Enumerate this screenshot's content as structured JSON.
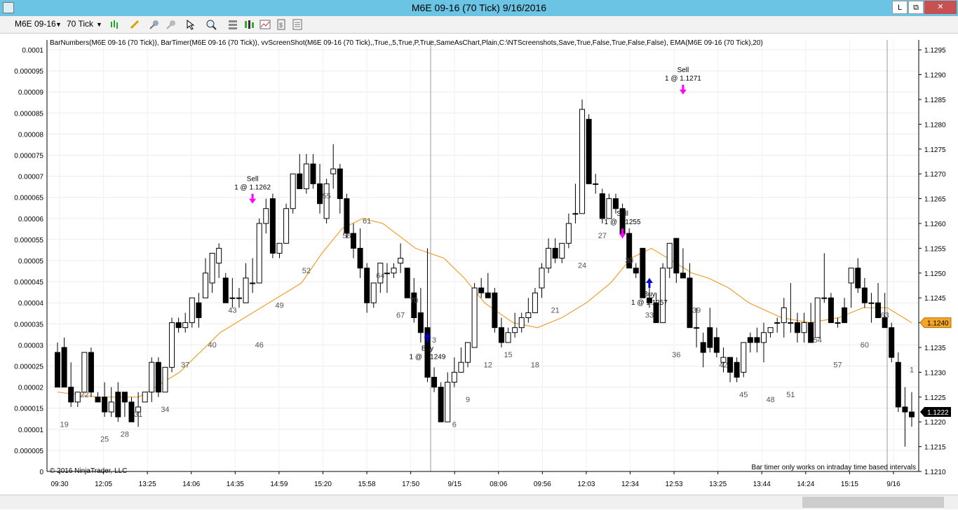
{
  "window": {
    "title": "M6E 09-16 (70 Tick)  9/16/2016",
    "help_label": "L",
    "restore_label": "⧉",
    "close_label": "✕"
  },
  "toolbar": {
    "instrument": "M6E 09-16",
    "interval": "70 Tick",
    "dropdown_icon": "chevron-down-icon"
  },
  "chart": {
    "indicator_label": "BarNumbers(M6E 09-16 (70 Tick)), BarTimer(M6E 09-16 (70 Tick)), vvScreenShot(M6E 09-16 (70 Tick),,True,,5,True,P,True,SameAsChart,Plain,C:\\NTScreenshots,Save,True,False,True,False,False), EMA(M6E 09-16 (70 Tick),20)",
    "copyright": "© 2016 NinjaTrader, LLC",
    "bartimer_msg": "Bar timer only works on intraday time based intervals",
    "left_ticks": [
      "0.0001",
      "0.000095",
      "0.00009",
      "0.000085",
      "0.00008",
      "0.000075",
      "0.00007",
      "0.000065",
      "0.00006",
      "0.000055",
      "0.00005",
      "0.000045",
      "0.00004",
      "0.000035",
      "0.00003",
      "0.000025",
      "0.00002",
      "0.000015",
      "0.00001",
      "0.000005",
      "0"
    ],
    "right_ticks": [
      "1.1295",
      "1.1290",
      "1.1285",
      "1.1280",
      "1.1275",
      "1.1270",
      "1.1265",
      "1.1260",
      "1.1255",
      "1.1250",
      "1.1245",
      "1.1240",
      "1.1235",
      "1.1230",
      "1.1225",
      "1.1220",
      "1.1215",
      "1.1210"
    ],
    "x_labels": [
      "09:30",
      "12:05",
      "13:25",
      "14:06",
      "14:35",
      "14:59",
      "15:20",
      "15:58",
      "17:50",
      "9/15",
      "08:06",
      "09:56",
      "12:03",
      "12:34",
      "12:53",
      "13:25",
      "13:44",
      "14:24",
      "15:15",
      "9/16"
    ],
    "price_ylim": [
      1.121,
      1.1297
    ],
    "last_price": "1.1222",
    "ema_price": "1.1240",
    "colors": {
      "ema": "#f0a030",
      "marker": "#ff00ff",
      "buy": "#0000cc",
      "price_tag": "#f5a623"
    },
    "bars": [
      [
        1.1234,
        1.1236,
        1.1227,
        1.1227
      ],
      [
        1.1235,
        1.1237,
        1.1227,
        1.1227
      ],
      [
        1.1227,
        1.1232,
        1.1223,
        1.1224
      ],
      [
        1.1224,
        1.1226,
        1.1223,
        1.1226
      ],
      [
        1.1226,
        1.1234,
        1.1226,
        1.1234
      ],
      [
        1.1234,
        1.1235,
        1.1225,
        1.1226
      ],
      [
        1.1225,
        1.1226,
        1.1224,
        1.1224
      ],
      [
        1.1225,
        1.1228,
        1.1221,
        1.1222
      ],
      [
        1.1222,
        1.1227,
        1.1221,
        1.1224
      ],
      [
        1.1226,
        1.1228,
        1.122,
        1.1221
      ],
      [
        1.1226,
        1.1226,
        1.1221,
        1.1224
      ],
      [
        1.1224,
        1.1225,
        1.122,
        1.122
      ],
      [
        1.1222,
        1.1226,
        1.1219,
        1.1223
      ],
      [
        1.1224,
        1.1226,
        1.1224,
        1.1226
      ],
      [
        1.1226,
        1.1233,
        1.1224,
        1.1232
      ],
      [
        1.1232,
        1.1233,
        1.1225,
        1.1226
      ],
      [
        1.1226,
        1.1231,
        1.1226,
        1.1231
      ],
      [
        1.1231,
        1.1241,
        1.123,
        1.124
      ],
      [
        1.124,
        1.1241,
        1.1238,
        1.1239
      ],
      [
        1.1239,
        1.1242,
        1.1238,
        1.124
      ],
      [
        1.124,
        1.1245,
        1.1239,
        1.1245
      ],
      [
        1.1244,
        1.1246,
        1.1239,
        1.1241
      ],
      [
        1.1245,
        1.1253,
        1.1245,
        1.125
      ],
      [
        1.1248,
        1.1254,
        1.1246,
        1.1254
      ],
      [
        1.1252,
        1.1256,
        1.1249,
        1.1255
      ],
      [
        1.1249,
        1.125,
        1.1244,
        1.1244
      ],
      [
        1.1245,
        1.1249,
        1.1243,
        1.1245
      ],
      [
        1.1245,
        1.1247,
        1.1243,
        1.1245
      ],
      [
        1.1244,
        1.1252,
        1.1244,
        1.1249
      ],
      [
        1.1248,
        1.1253,
        1.1246,
        1.1248
      ],
      [
        1.1248,
        1.1261,
        1.1248,
        1.126
      ],
      [
        1.126,
        1.1265,
        1.1258,
        1.1263
      ],
      [
        1.1265,
        1.1266,
        1.1253,
        1.1254
      ],
      [
        1.1254,
        1.1256,
        1.1253,
        1.1256
      ],
      [
        1.1256,
        1.1264,
        1.1256,
        1.1263
      ],
      [
        1.1263,
        1.127,
        1.1262,
        1.127
      ],
      [
        1.127,
        1.1274,
        1.1267,
        1.1267
      ],
      [
        1.1267,
        1.1274,
        1.1266,
        1.1272
      ],
      [
        1.1272,
        1.1274,
        1.1267,
        1.1268
      ],
      [
        1.1268,
        1.1272,
        1.1262,
        1.1264
      ],
      [
        1.1261,
        1.1269,
        1.126,
        1.1268
      ],
      [
        1.127,
        1.1276,
        1.1267,
        1.1271
      ],
      [
        1.1271,
        1.1272,
        1.1262,
        1.1265
      ],
      [
        1.1265,
        1.1266,
        1.1257,
        1.1258
      ],
      [
        1.1258,
        1.126,
        1.1253,
        1.1255
      ],
      [
        1.1255,
        1.1259,
        1.1249,
        1.1251
      ],
      [
        1.1251,
        1.1252,
        1.1242,
        1.1244
      ],
      [
        1.1244,
        1.1248,
        1.1243,
        1.1248
      ],
      [
        1.1248,
        1.1252,
        1.1246,
        1.1252
      ],
      [
        1.125,
        1.1252,
        1.1246,
        1.125
      ],
      [
        1.125,
        1.1252,
        1.1249,
        1.1251
      ],
      [
        1.1252,
        1.1256,
        1.125,
        1.1253
      ],
      [
        1.1251,
        1.1251,
        1.1245,
        1.1245
      ],
      [
        1.1246,
        1.1249,
        1.124,
        1.1241
      ],
      [
        1.1242,
        1.1247,
        1.1236,
        1.1238
      ],
      [
        1.1239,
        1.1255,
        1.1228,
        1.1229
      ],
      [
        1.1229,
        1.1231,
        1.1226,
        1.1227
      ],
      [
        1.1227,
        1.1228,
        1.122,
        1.122
      ],
      [
        1.122,
        1.123,
        1.122,
        1.1228
      ],
      [
        1.1228,
        1.1233,
        1.1227,
        1.123
      ],
      [
        1.123,
        1.1235,
        1.123,
        1.1232
      ],
      [
        1.1232,
        1.1236,
        1.1231,
        1.1236
      ],
      [
        1.1235,
        1.1248,
        1.1235,
        1.1247
      ],
      [
        1.1247,
        1.1249,
        1.1245,
        1.1246
      ],
      [
        1.1246,
        1.125,
        1.1245,
        1.1245
      ],
      [
        1.1246,
        1.1247,
        1.1238,
        1.1239
      ],
      [
        1.1239,
        1.1241,
        1.1235,
        1.1236
      ],
      [
        1.1236,
        1.1239,
        1.1236,
        1.1238
      ],
      [
        1.1238,
        1.1242,
        1.1237,
        1.1239
      ],
      [
        1.1239,
        1.1242,
        1.1238,
        1.1241
      ],
      [
        1.1241,
        1.1245,
        1.124,
        1.1242
      ],
      [
        1.1242,
        1.1247,
        1.1242,
        1.1246
      ],
      [
        1.1247,
        1.1252,
        1.1245,
        1.1251
      ],
      [
        1.1251,
        1.1257,
        1.125,
        1.1255
      ],
      [
        1.1255,
        1.1257,
        1.1252,
        1.1253
      ],
      [
        1.1253,
        1.1256,
        1.1252,
        1.1256
      ],
      [
        1.1256,
        1.1262,
        1.1255,
        1.126
      ],
      [
        1.1262,
        1.1268,
        1.126,
        1.1262
      ],
      [
        1.1262,
        1.1285,
        1.1262,
        1.1283
      ],
      [
        1.1281,
        1.1282,
        1.1268,
        1.1268
      ],
      [
        1.1268,
        1.127,
        1.1266,
        1.1268
      ],
      [
        1.1266,
        1.1267,
        1.126,
        1.1261
      ],
      [
        1.1261,
        1.1266,
        1.1261,
        1.1265
      ],
      [
        1.1265,
        1.1266,
        1.1262,
        1.1263
      ],
      [
        1.1263,
        1.1264,
        1.1257,
        1.1258
      ],
      [
        1.1258,
        1.1259,
        1.1251,
        1.1251
      ],
      [
        1.1251,
        1.1252,
        1.1249,
        1.125
      ],
      [
        1.1255,
        1.1255,
        1.1245,
        1.1245
      ],
      [
        1.1245,
        1.1249,
        1.1243,
        1.1244
      ],
      [
        1.1244,
        1.1246,
        1.124,
        1.124
      ],
      [
        1.124,
        1.1252,
        1.124,
        1.1251
      ],
      [
        1.1251,
        1.1256,
        1.1249,
        1.1256
      ],
      [
        1.1257,
        1.1257,
        1.1248,
        1.125
      ],
      [
        1.125,
        1.1255,
        1.1249,
        1.1249
      ],
      [
        1.1249,
        1.1252,
        1.1239,
        1.1239
      ],
      [
        1.1239,
        1.1243,
        1.1235,
        1.1239
      ],
      [
        1.1236,
        1.1238,
        1.1231,
        1.1234
      ],
      [
        1.1239,
        1.1243,
        1.1234,
        1.1235
      ],
      [
        1.1237,
        1.1239,
        1.1233,
        1.1234
      ],
      [
        1.1232,
        1.1235,
        1.123,
        1.1233
      ],
      [
        1.1233,
        1.1233,
        1.1228,
        1.123
      ],
      [
        1.1232,
        1.1233,
        1.1228,
        1.1229
      ],
      [
        1.123,
        1.1236,
        1.1229,
        1.1236
      ],
      [
        1.1237,
        1.1238,
        1.1234,
        1.1236
      ],
      [
        1.1237,
        1.1239,
        1.1234,
        1.1236
      ],
      [
        1.1236,
        1.124,
        1.1232,
        1.1238
      ],
      [
        1.1238,
        1.1239,
        1.1237,
        1.1239
      ],
      [
        1.124,
        1.1241,
        1.1238,
        1.124
      ],
      [
        1.124,
        1.1245,
        1.1237,
        1.1243
      ],
      [
        1.124,
        1.1248,
        1.1238,
        1.124
      ],
      [
        1.124,
        1.1242,
        1.1236,
        1.1238
      ],
      [
        1.1238,
        1.1242,
        1.1236,
        1.124
      ],
      [
        1.124,
        1.1244,
        1.1236,
        1.1236
      ],
      [
        1.1237,
        1.1245,
        1.1237,
        1.1245
      ],
      [
        1.1245,
        1.1254,
        1.1244,
        1.1245
      ],
      [
        1.1245,
        1.1246,
        1.124,
        1.124
      ],
      [
        1.124,
        1.1241,
        1.1239,
        1.124
      ],
      [
        1.1243,
        1.1245,
        1.124,
        1.124
      ],
      [
        1.1248,
        1.1251,
        1.1243,
        1.1251
      ],
      [
        1.1251,
        1.1253,
        1.1246,
        1.1247
      ],
      [
        1.1247,
        1.1249,
        1.1243,
        1.1244
      ],
      [
        1.1244,
        1.1246,
        1.124,
        1.1244
      ],
      [
        1.1244,
        1.1248,
        1.1242,
        1.1241
      ],
      [
        1.1241,
        1.1246,
        1.1239,
        1.1239
      ],
      [
        1.1239,
        1.124,
        1.1232,
        1.1233
      ],
      [
        1.1232,
        1.1234,
        1.1222,
        1.1223
      ],
      [
        1.1223,
        1.1227,
        1.1215,
        1.1222
      ],
      [
        1.1222,
        1.1226,
        1.1219,
        1.1221
      ]
    ],
    "ema_points": [
      [
        0,
        1.1226
      ],
      [
        10,
        1.1225
      ],
      [
        20,
        1.1225
      ],
      [
        30,
        1.123
      ],
      [
        40,
        1.1238
      ],
      [
        50,
        1.1243
      ],
      [
        60,
        1.1248
      ],
      [
        65,
        1.1254
      ],
      [
        70,
        1.1259
      ],
      [
        75,
        1.1261
      ],
      [
        80,
        1.126
      ],
      [
        88,
        1.1255
      ],
      [
        95,
        1.1253
      ],
      [
        100,
        1.1249
      ],
      [
        105,
        1.1244
      ],
      [
        112,
        1.124
      ],
      [
        118,
        1.1239
      ],
      [
        124,
        1.1241
      ],
      [
        130,
        1.1244
      ],
      [
        136,
        1.1248
      ],
      [
        141,
        1.1253
      ],
      [
        146,
        1.1255
      ],
      [
        150,
        1.1253
      ],
      [
        156,
        1.125
      ],
      [
        160,
        1.1249
      ],
      [
        165,
        1.1247
      ],
      [
        170,
        1.1244
      ],
      [
        178,
        1.1241
      ],
      [
        185,
        1.124
      ],
      [
        192,
        1.1241
      ],
      [
        198,
        1.1243
      ],
      [
        204,
        1.1243
      ],
      [
        210,
        1.124
      ]
    ],
    "bar_numbers": [
      {
        "text": "19",
        "idx": 1
      },
      {
        "text": "22",
        "idx": 5
      },
      {
        "text": "25",
        "idx": 8
      },
      {
        "text": "28",
        "idx": 11
      },
      {
        "text": "31",
        "idx": 14
      },
      {
        "text": "34",
        "idx": 18
      },
      {
        "text": "37",
        "idx": 22
      },
      {
        "text": "40",
        "idx": 26
      },
      {
        "text": "43",
        "idx": 30
      },
      {
        "text": "46",
        "idx": 34
      },
      {
        "text": "49",
        "idx": 38
      },
      {
        "text": "52",
        "idx": 42
      },
      {
        "text": "55",
        "idx": 46
      },
      {
        "text": "58",
        "idx": 49
      },
      {
        "text": "61",
        "idx": 52
      },
      {
        "text": "64",
        "idx": 55
      },
      {
        "text": "67",
        "idx": 58
      },
      {
        "text": "70",
        "idx": 61
      },
      {
        "text": "3",
        "idx": 64
      },
      {
        "text": "6",
        "idx": 67
      },
      {
        "text": "9",
        "idx": 70
      },
      {
        "text": "12",
        "idx": 73
      },
      {
        "text": "15",
        "idx": 77
      },
      {
        "text": "18",
        "idx": 81
      },
      {
        "text": "21",
        "idx": 85
      },
      {
        "text": "24",
        "idx": 89
      },
      {
        "text": "27",
        "idx": 93
      },
      {
        "text": "30",
        "idx": 97
      },
      {
        "text": "33",
        "idx": 101
      },
      {
        "text": "36",
        "idx": 105
      },
      {
        "text": "39",
        "idx": 109
      },
      {
        "text": "42",
        "idx": 113
      },
      {
        "text": "45",
        "idx": 117
      },
      {
        "text": "48",
        "idx": 121
      },
      {
        "text": "51",
        "idx": 125
      },
      {
        "text": "54",
        "idx": 129
      },
      {
        "text": "57",
        "idx": 133
      },
      {
        "text": "60",
        "idx": 137
      },
      {
        "text": "63",
        "idx": 141
      },
      {
        "text": "1",
        "idx": 145
      }
    ],
    "bar_number_prices": [
      1.1219,
      1.1225,
      1.1216,
      1.1217,
      1.1221,
      1.1222,
      1.1231,
      1.1235,
      1.1242,
      1.1235,
      1.1243,
      1.125,
      1.1265,
      1.1257,
      1.126,
      1.1249,
      1.1241,
      1.1244,
      1.1236,
      1.1219,
      1.1224,
      1.1231,
      1.1233,
      1.1231,
      1.1242,
      1.1251,
      1.1257,
      1.1252,
      1.1241,
      1.1233,
      1.1242,
      1.1231,
      1.1225,
      1.1224,
      1.1225,
      1.1236,
      1.1231,
      1.1235,
      1.1241,
      1.123
    ],
    "trades": [
      {
        "type": "Sell",
        "label": "Sell",
        "price_label": "1 @ 1.1262",
        "idx": 33,
        "price": 1.1264
      },
      {
        "type": "Buy",
        "label": "Buy",
        "price_label": "1 @ 1.1249",
        "idx": 63,
        "price": 1.1238
      },
      {
        "type": "Sell",
        "label": "Sell",
        "price_label": "1 @ 1.1255",
        "idx": 96,
        "price": 1.1257
      },
      {
        "type": "Buy",
        "label": "Buy",
        "price_label": "1 @ 1.1257",
        "idx": 100,
        "price": 1.1249
      },
      {
        "type": "Sell",
        "label": "Sell",
        "price_label": "1 @ 1.1271",
        "idx": 106,
        "price": 1.1286
      }
    ]
  }
}
